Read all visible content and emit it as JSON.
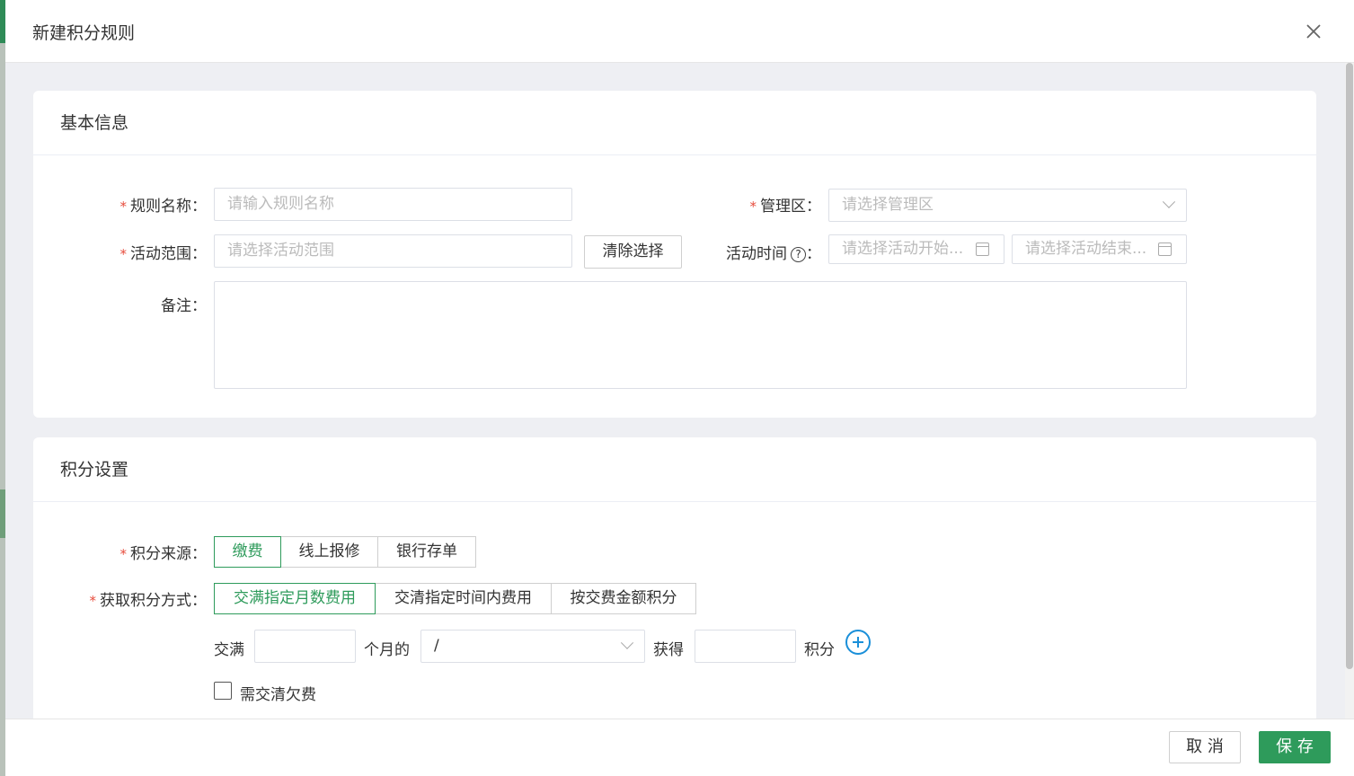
{
  "modal": {
    "title": "新建积分规则"
  },
  "basic_info": {
    "section_title": "基本信息",
    "rule_name": {
      "label": "规则名称：",
      "placeholder": "请输入规则名称"
    },
    "management_area": {
      "label": "管理区：",
      "placeholder": "请选择管理区"
    },
    "activity_scope": {
      "label": "活动范围：",
      "placeholder": "请选择活动范围",
      "clear_button": "清除选择"
    },
    "activity_time": {
      "label": "活动时间",
      "colon": "：",
      "help": "?",
      "start_placeholder": "请选择活动开始...",
      "end_placeholder": "请选择活动结束..."
    },
    "remark": {
      "label": "备注："
    }
  },
  "points_settings": {
    "section_title": "积分设置",
    "source": {
      "label": "积分来源：",
      "options": [
        "缴费",
        "线上报修",
        "银行存单"
      ],
      "selected": "缴费"
    },
    "method": {
      "label": "获取积分方式：",
      "options": [
        "交满指定月数费用",
        "交清指定时间内费用",
        "按交费金额积分"
      ],
      "selected": "交满指定月数费用"
    },
    "rule_row": {
      "prefix": "交满",
      "months_value": "",
      "months_suffix": "个月的",
      "select_value": "/",
      "gain_label": "获得",
      "points_value": "",
      "points_suffix": "积分"
    },
    "arrears_checkbox": {
      "label": "需交清欠费",
      "checked": false
    }
  },
  "footer": {
    "cancel": "取 消",
    "save": "保 存"
  },
  "colors": {
    "accent": "#2e9b5b",
    "required": "#e74c3c",
    "plus": "#1a8fd9"
  }
}
